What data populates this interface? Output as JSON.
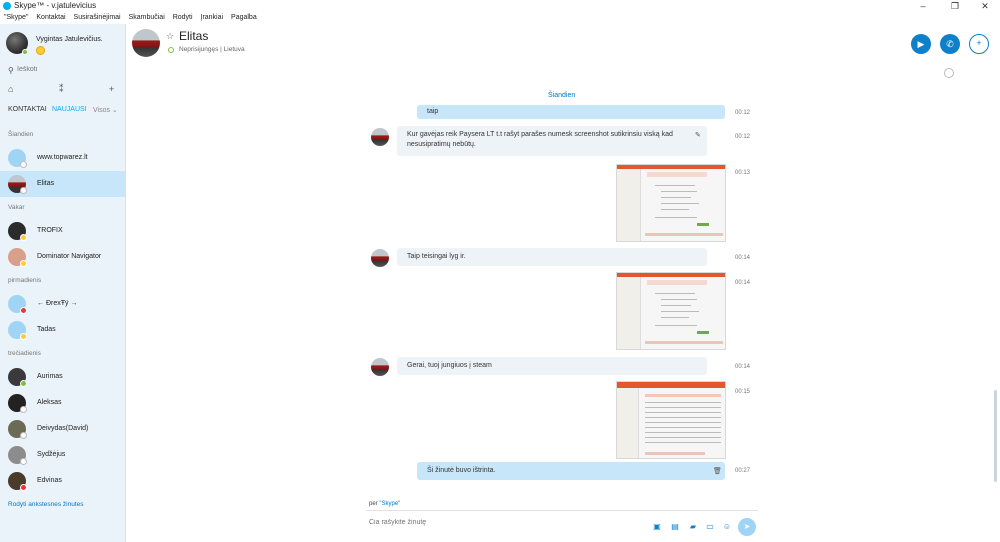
{
  "window": {
    "title": "Skype™ - v.jatulevicius",
    "controls": [
      "–",
      "❐",
      "✕"
    ]
  },
  "menu": [
    "\"Skype\"",
    "Kontaktai",
    "Susirašinėjimai",
    "Skambučiai",
    "Rodyti",
    "Įrankiai",
    "Pagalba"
  ],
  "profile": {
    "name": "Vygintas Jatulevičius."
  },
  "search": {
    "placeholder": "Ieškoti"
  },
  "tabs": {
    "contacts": "KONTAKTAI",
    "recent": "NAUJAUSI",
    "filter": "Visos ⌄"
  },
  "sidebar": {
    "sections": [
      "Šiandien",
      "Vakar",
      "pirmadienis",
      "trečiadienis"
    ],
    "contacts": [
      {
        "name": "www.topwarez.lt"
      },
      {
        "name": "Elitas"
      },
      {
        "name": "TROFIX"
      },
      {
        "name": "Dominator Navigator"
      },
      {
        "name": "← ĐrexŦÿ →"
      },
      {
        "name": "Tadas"
      },
      {
        "name": "Aurimas"
      },
      {
        "name": "Aleksas"
      },
      {
        "name": "Deivydas(David)"
      },
      {
        "name": "Sydžėjus"
      },
      {
        "name": "Edvinas"
      }
    ],
    "older_link": "Rodyti ankstesnes žinutes"
  },
  "conversation": {
    "title": "Elitas",
    "status": "Neprisijungęs | Lietuva",
    "day_label": "Šiandien",
    "messages": [
      {
        "text": "taip",
        "time": "00:12"
      },
      {
        "text": "Kur gavėjas reik Paysera LT t.t rašyt parašes numesk screenshot sutikrinsiu viską kad nesusipratimų nebūtų.",
        "time": "00:12"
      },
      {
        "text": "",
        "time": "00:13"
      },
      {
        "text": "Taip teisingai lyg ir.",
        "time": "00:14"
      },
      {
        "text": "",
        "time": "00:14"
      },
      {
        "text": "Gerai, tuoj jungiuos į steam",
        "time": "00:14"
      },
      {
        "text": "",
        "time": "00:15"
      },
      {
        "text": "Ši žinutė buvo ištrinta.",
        "time": "00:27"
      }
    ]
  },
  "compose": {
    "via_prefix": "per",
    "via_service": "\"Skype\"",
    "placeholder": "Čia rašykite žinutę"
  }
}
